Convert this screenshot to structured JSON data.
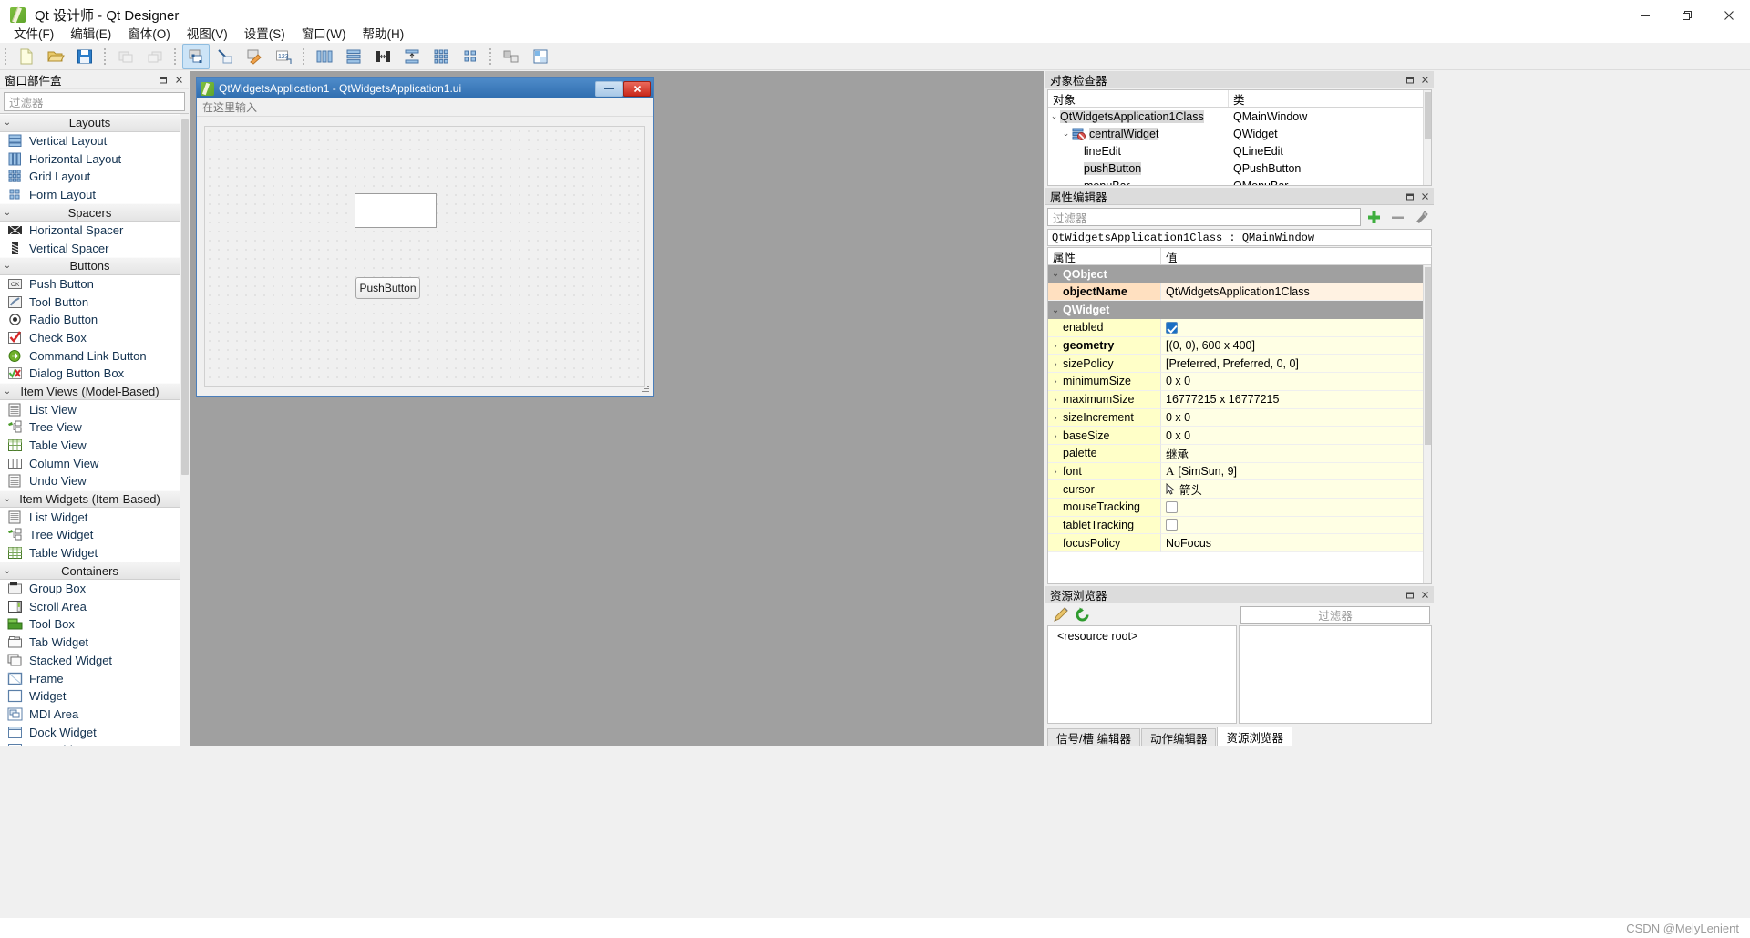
{
  "window": {
    "title": "Qt 设计师 - Qt Designer",
    "app_icon": "qt-designer-icon",
    "minimize_label": "最小化",
    "restore_label": "还原",
    "close_label": "关闭"
  },
  "menubar": {
    "items": [
      {
        "label": "文件(F)",
        "name": "menu-file"
      },
      {
        "label": "编辑(E)",
        "name": "menu-edit"
      },
      {
        "label": "窗体(O)",
        "name": "menu-form"
      },
      {
        "label": "视图(V)",
        "name": "menu-view"
      },
      {
        "label": "设置(S)",
        "name": "menu-settings"
      },
      {
        "label": "窗口(W)",
        "name": "menu-window"
      },
      {
        "label": "帮助(H)",
        "name": "menu-help"
      }
    ]
  },
  "toolbar": {
    "groups": [
      {
        "buttons": [
          {
            "name": "new-file-icon",
            "state": "normal"
          },
          {
            "name": "open-file-icon",
            "state": "normal"
          },
          {
            "name": "save-file-icon",
            "state": "normal"
          }
        ]
      },
      {
        "buttons": [
          {
            "name": "undo-icon",
            "state": "disabled"
          },
          {
            "name": "redo-icon",
            "state": "disabled"
          }
        ]
      },
      {
        "buttons": [
          {
            "name": "edit-widgets-icon",
            "state": "active"
          },
          {
            "name": "edit-signals-slots-icon",
            "state": "normal"
          },
          {
            "name": "edit-buddies-icon",
            "state": "normal"
          },
          {
            "name": "edit-tab-order-icon",
            "state": "normal"
          }
        ]
      },
      {
        "buttons": [
          {
            "name": "layout-horizontally-icon",
            "state": "normal"
          },
          {
            "name": "layout-vertically-icon",
            "state": "normal"
          },
          {
            "name": "layout-splitter-horizontal-icon",
            "state": "normal"
          },
          {
            "name": "layout-splitter-vertical-icon",
            "state": "normal"
          },
          {
            "name": "layout-grid-icon",
            "state": "normal"
          },
          {
            "name": "layout-form-icon",
            "state": "normal"
          }
        ]
      },
      {
        "buttons": [
          {
            "name": "break-layout-icon",
            "state": "normal"
          },
          {
            "name": "adjust-size-icon",
            "state": "normal"
          }
        ]
      }
    ]
  },
  "widget_box": {
    "title": "窗口部件盒",
    "float_button": "float-icon",
    "close_button": "close-icon",
    "filter_placeholder": "过滤器",
    "categories": [
      {
        "name": "layouts",
        "label": "Layouts",
        "expanded": true,
        "items": [
          {
            "label": "Vertical Layout",
            "icon": "vertical-layout-icon"
          },
          {
            "label": "Horizontal Layout",
            "icon": "horizontal-layout-icon"
          },
          {
            "label": "Grid Layout",
            "icon": "grid-layout-icon"
          },
          {
            "label": "Form Layout",
            "icon": "form-layout-icon"
          }
        ]
      },
      {
        "name": "spacers",
        "label": "Spacers",
        "expanded": true,
        "items": [
          {
            "label": "Horizontal Spacer",
            "icon": "horizontal-spacer-icon"
          },
          {
            "label": "Vertical Spacer",
            "icon": "vertical-spacer-icon"
          }
        ]
      },
      {
        "name": "buttons",
        "label": "Buttons",
        "expanded": true,
        "items": [
          {
            "label": "Push Button",
            "icon": "push-button-icon"
          },
          {
            "label": "Tool Button",
            "icon": "tool-button-icon"
          },
          {
            "label": "Radio Button",
            "icon": "radio-button-icon"
          },
          {
            "label": "Check Box",
            "icon": "check-box-icon"
          },
          {
            "label": "Command Link Button",
            "icon": "command-link-button-icon"
          },
          {
            "label": "Dialog Button Box",
            "icon": "dialog-button-box-icon"
          }
        ]
      },
      {
        "name": "item-views-model-based",
        "label": "Item Views (Model-Based)",
        "expanded": true,
        "items": [
          {
            "label": "List View",
            "icon": "list-view-icon"
          },
          {
            "label": "Tree View",
            "icon": "tree-view-icon"
          },
          {
            "label": "Table View",
            "icon": "table-view-icon"
          },
          {
            "label": "Column View",
            "icon": "column-view-icon"
          },
          {
            "label": "Undo View",
            "icon": "undo-view-icon"
          }
        ]
      },
      {
        "name": "item-widgets-item-based",
        "label": "Item Widgets (Item-Based)",
        "expanded": true,
        "items": [
          {
            "label": "List Widget",
            "icon": "list-widget-icon"
          },
          {
            "label": "Tree Widget",
            "icon": "tree-widget-icon"
          },
          {
            "label": "Table Widget",
            "icon": "table-widget-icon"
          }
        ]
      },
      {
        "name": "containers",
        "label": "Containers",
        "expanded": true,
        "items": [
          {
            "label": "Group Box",
            "icon": "group-box-icon"
          },
          {
            "label": "Scroll Area",
            "icon": "scroll-area-icon"
          },
          {
            "label": "Tool Box",
            "icon": "tool-box-icon"
          },
          {
            "label": "Tab Widget",
            "icon": "tab-widget-icon"
          },
          {
            "label": "Stacked Widget",
            "icon": "stacked-widget-icon"
          },
          {
            "label": "Frame",
            "icon": "frame-icon"
          },
          {
            "label": "Widget",
            "icon": "widget-icon"
          },
          {
            "label": "MDI Area",
            "icon": "mdi-area-icon"
          },
          {
            "label": "Dock Widget",
            "icon": "dock-widget-icon"
          },
          {
            "label": "QAxWidget",
            "icon": "qax-widget-icon"
          }
        ]
      }
    ]
  },
  "form_window": {
    "title": "QtWidgetsApplication1 - QtWidgetsApplication1.ui",
    "icon": "qt-form-icon",
    "minimize_label": "最小化",
    "close_label": "关闭",
    "menu_placeholder": "在这里输入",
    "widgets": {
      "line_edit": {
        "name": "lineEdit",
        "value": ""
      },
      "push_button": {
        "name": "pushButton",
        "label": "PushButton"
      }
    }
  },
  "object_inspector": {
    "title": "对象检查器",
    "float_button": "float-icon",
    "close_button": "close-icon",
    "columns": [
      "对象",
      "类"
    ],
    "rows": [
      {
        "indent": 0,
        "chevron": "v",
        "icon": "",
        "object": "QtWidgetsApplication1Class",
        "class": "QMainWindow",
        "selected": true
      },
      {
        "indent": 1,
        "chevron": "v",
        "icon": "central-widget-icon",
        "object": "centralWidget",
        "class": "QWidget",
        "selected": true
      },
      {
        "indent": 2,
        "chevron": "",
        "icon": "",
        "object": "lineEdit",
        "class": "QLineEdit",
        "selected": false
      },
      {
        "indent": 2,
        "chevron": "",
        "icon": "",
        "object": "pushButton",
        "class": "QPushButton",
        "selected": true
      },
      {
        "indent": 2,
        "chevron": "",
        "icon": "",
        "object": "menuBar",
        "class": "QMenuBar",
        "selected": false
      }
    ]
  },
  "property_editor": {
    "title": "属性编辑器",
    "float_button": "float-icon",
    "close_button": "close-icon",
    "filter_placeholder": "过滤器",
    "add_button": "add-icon",
    "remove_button": "remove-icon",
    "configure_button": "configure-icon",
    "class_label": "QtWidgetsApplication1Class : QMainWindow",
    "columns": [
      "属性",
      "值"
    ],
    "rows": [
      {
        "type": "group",
        "name": "QObject",
        "value": "",
        "chevron": "v"
      },
      {
        "type": "prop",
        "name": "objectName",
        "value": "QtWidgetsApplication1Class",
        "tone": "peach",
        "bold": true,
        "chevron": ""
      },
      {
        "type": "group",
        "name": "QWidget",
        "value": "",
        "chevron": "v"
      },
      {
        "type": "prop",
        "name": "enabled",
        "value": "",
        "tone": "yellow",
        "control": "checkbox-on",
        "chevron": ""
      },
      {
        "type": "prop",
        "name": "geometry",
        "value": "[(0, 0), 600 x 400]",
        "tone": "yellow",
        "bold": true,
        "chevron": ">"
      },
      {
        "type": "prop",
        "name": "sizePolicy",
        "value": "[Preferred, Preferred, 0, 0]",
        "tone": "yellow",
        "chevron": ">"
      },
      {
        "type": "prop",
        "name": "minimumSize",
        "value": "0 x 0",
        "tone": "yellow",
        "chevron": ">"
      },
      {
        "type": "prop",
        "name": "maximumSize",
        "value": "16777215 x 16777215",
        "tone": "yellow",
        "chevron": ">"
      },
      {
        "type": "prop",
        "name": "sizeIncrement",
        "value": "0 x 0",
        "tone": "yellow",
        "chevron": ">"
      },
      {
        "type": "prop",
        "name": "baseSize",
        "value": "0 x 0",
        "tone": "yellow",
        "chevron": ">"
      },
      {
        "type": "prop",
        "name": "palette",
        "value": "继承",
        "tone": "yellow",
        "chevron": ""
      },
      {
        "type": "prop",
        "name": "font",
        "value": "[SimSun, 9]",
        "tone": "yellow",
        "control": "font-icon",
        "chevron": ">"
      },
      {
        "type": "prop",
        "name": "cursor",
        "value": "箭头",
        "tone": "yellow",
        "control": "cursor-icon",
        "chevron": ""
      },
      {
        "type": "prop",
        "name": "mouseTracking",
        "value": "",
        "tone": "yellow",
        "control": "checkbox-off",
        "chevron": ""
      },
      {
        "type": "prop",
        "name": "tabletTracking",
        "value": "",
        "tone": "yellow",
        "control": "checkbox-off",
        "chevron": ""
      },
      {
        "type": "prop",
        "name": "focusPolicy",
        "value": "NoFocus",
        "tone": "yellow",
        "chevron": ""
      }
    ]
  },
  "resource_browser": {
    "title": "资源浏览器",
    "float_button": "float-icon",
    "close_button": "close-icon",
    "edit_button": "pencil-icon",
    "reload_button": "reload-icon",
    "filter_placeholder": "过滤器",
    "root_label": "<resource root>"
  },
  "bottom_tabs": {
    "tabs": [
      {
        "label": "信号/槽 编辑器",
        "name": "tab-signal-slot-editor",
        "active": false
      },
      {
        "label": "动作编辑器",
        "name": "tab-action-editor",
        "active": false
      },
      {
        "label": "资源浏览器",
        "name": "tab-resource-browser",
        "active": true
      }
    ]
  },
  "watermark": "CSDN @MelyLenient"
}
